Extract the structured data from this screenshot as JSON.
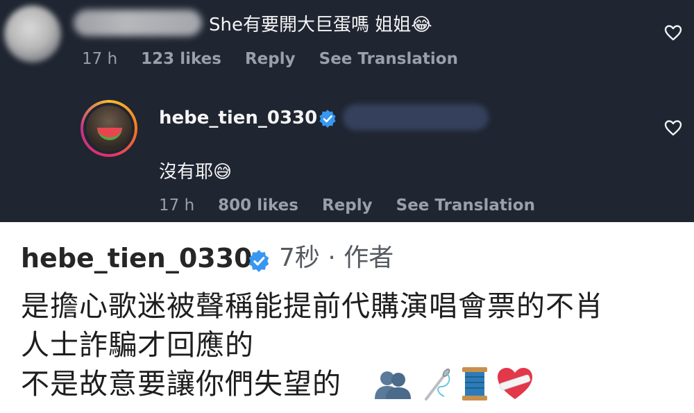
{
  "comment1": {
    "text": "She有要開大巨蛋嗎 姐姐😂",
    "time": "17 h",
    "likes": "123 likes",
    "reply": "Reply",
    "translate": "See Translation"
  },
  "comment2": {
    "username": "hebe_tien_0330",
    "text": "沒有耶😅",
    "time": "17 h",
    "likes": "800 likes",
    "reply": "Reply",
    "translate": "See Translation"
  },
  "post": {
    "username": "hebe_tien_0330",
    "meta": "7秒 · 作者",
    "line1": "是擔心歌迷被聲稱能提前代購演唱會票的不肖",
    "line2": "人士詐騙才回應的",
    "line3": "不是故意要讓你們失望的"
  },
  "icons": {
    "heart": "heart-outline-icon",
    "verified": "verified-badge-icon",
    "emojis": [
      "busts-in-silhouette-icon",
      "sewing-needle-icon",
      "spool-of-thread-icon",
      "mending-heart-icon"
    ]
  },
  "colors": {
    "dark_bg": "#1f2531",
    "verified_blue": "#3897f0",
    "muted": "#9aa0aa"
  }
}
